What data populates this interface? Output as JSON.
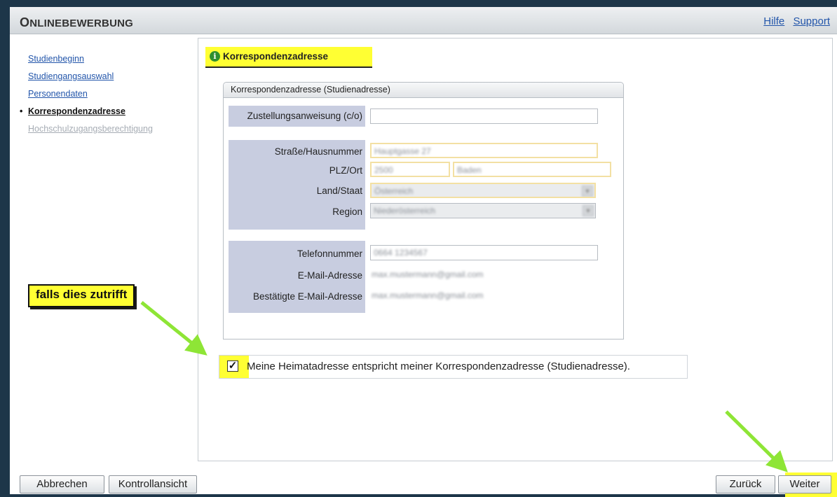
{
  "header": {
    "title_first": "O",
    "title_rest": "NLINEBEWERBUNG",
    "links": [
      "Hilfe",
      "Support"
    ]
  },
  "nav": {
    "items": [
      {
        "label": "Studienbeginn",
        "state": "link"
      },
      {
        "label": "Studiengangsauswahl",
        "state": "link"
      },
      {
        "label": "Personendaten",
        "state": "link"
      },
      {
        "label": "Korrespondenzadresse",
        "state": "active"
      },
      {
        "label": "Hochschulzugangsberechtigung",
        "state": "disabled"
      }
    ]
  },
  "section": {
    "title": "Korrespondenzadresse",
    "info_icon": "i"
  },
  "form": {
    "box_title": "Korrespondenzadresse (Studienadresse)",
    "co_label": "Zustellungsanweisung (c/o)",
    "co_value": "",
    "address_labels": [
      "Straße/Hausnummer",
      "PLZ/Ort",
      "Land/Staat",
      "Region"
    ],
    "contact_labels": [
      "Telefonnummer",
      "E-Mail-Adresse",
      "Bestätigte E-Mail-Adresse"
    ],
    "blurred_values": {
      "street": "Hauptgasse 27",
      "plz": "2500",
      "ort": "Baden",
      "land": "Österreich",
      "region": "Niederösterreich",
      "phone": "0664 1234567",
      "email": "max.mustermann@gmail.com",
      "email_confirmed": "max.mustermann@gmail.com"
    }
  },
  "annotation": {
    "callout": "falls dies zutrifft",
    "highlight_color": "#ffff33",
    "arrow_color": "#8ee536"
  },
  "checkbox": {
    "checked_glyph": "✓",
    "label": "Meine Heimatadresse entspricht meiner Korrespondenzadresse (Studienadresse)."
  },
  "buttons": {
    "cancel": "Abbrechen",
    "review": "Kontrollansicht",
    "back": "Zurück",
    "next": "Weiter"
  }
}
